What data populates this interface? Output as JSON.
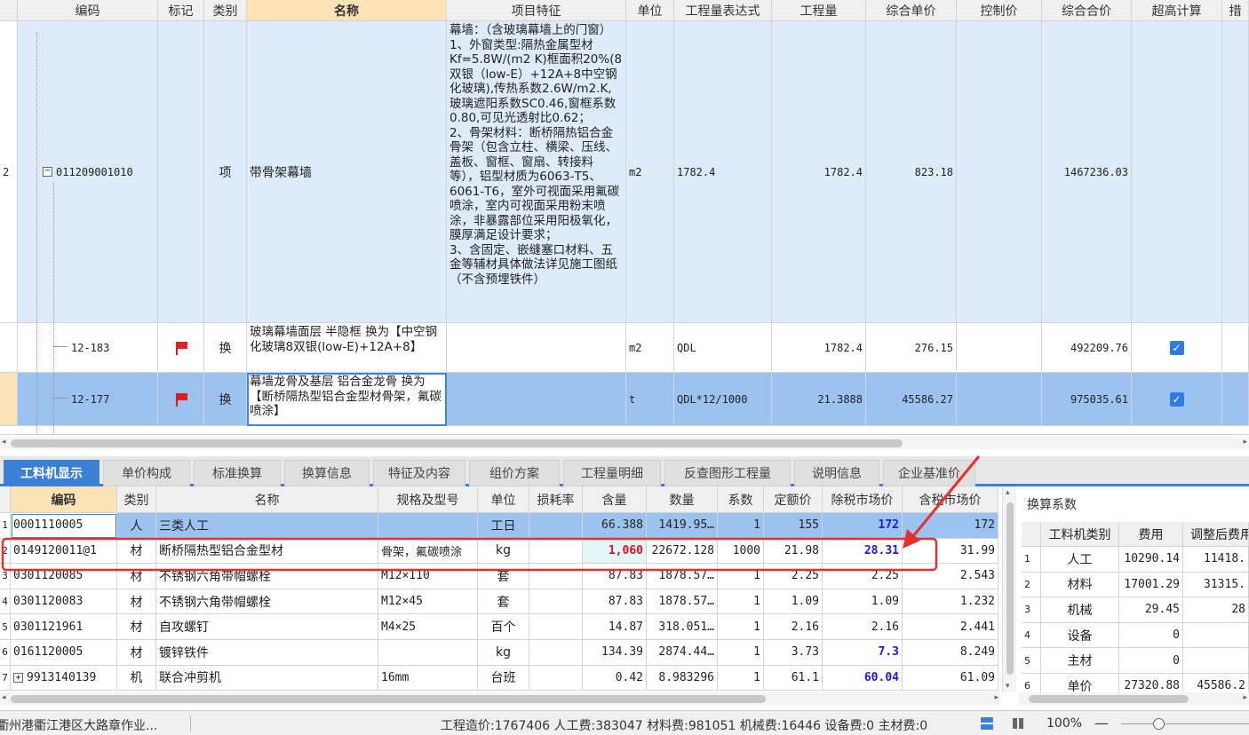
{
  "top_grid": {
    "headers": {
      "code": "编码",
      "mark": "标记",
      "type": "类别",
      "name": "名称",
      "features": "项目特征",
      "unit": "单位",
      "expr": "工程量表达式",
      "qty": "工程量",
      "unit_price": "综合单价",
      "control": "控制价",
      "total": "综合合价",
      "over_height": "超高计算",
      "extra": "措"
    },
    "rows": [
      {
        "rownum": "2",
        "code": "011209001010",
        "type": "项",
        "name": "带骨架幕墙",
        "features": "幕墙：（含玻璃幕墙上的门窗）\n1、外窗类型:隔热金属型材Kf=5.8W/(m2 K)框面积20%(8双银（low-E）+12A+8中空钢化玻璃),传热系数2.6W/m2.K,玻璃遮阳系数SC0.46,窗框系数0.80,可见光透射比0.62；\n2、骨架材料：断桥隔热铝合金骨架（包含立柱、横梁、压线、盖板、窗框、窗扇、转接料等），铝型材质为6063-T5、6061-T6，室外可视面采用氟碳喷涂，室内可视面采用粉末喷涂，非暴露部位采用阳极氧化，膜厚满足设计要求；\n3、含固定、嵌缝塞口材料、五金等辅材具体做法详见施工图纸（不含预埋铁件）",
        "unit": "m2",
        "expr": "1782.4",
        "qty": "1782.4",
        "unit_price": "823.18",
        "control": "",
        "total": "1467236.03"
      },
      {
        "rownum": "",
        "code": "12-183",
        "type": "换",
        "name": "玻璃幕墙面层 半隐框  换为【中空钢化玻璃8双银(low-E)+12A+8】",
        "features": "",
        "unit": "m2",
        "expr": "QDL",
        "qty": "1782.4",
        "unit_price": "276.15",
        "control": "",
        "total": "492209.76"
      },
      {
        "rownum": "",
        "code": "12-177",
        "type": "换",
        "name": "幕墙龙骨及基层 铝合金龙骨  换为【断桥隔热型铝合金型材骨架，氟碳喷涂】",
        "features": "",
        "unit": "t",
        "expr": "QDL*12/1000",
        "qty": "21.3888",
        "unit_price": "45586.27",
        "control": "",
        "total": "975035.61"
      }
    ]
  },
  "tabs": [
    "工料机显示",
    "单价构成",
    "标准换算",
    "换算信息",
    "特征及内容",
    "组价方案",
    "工程量明细",
    "反查图形工程量",
    "说明信息",
    "企业基准价"
  ],
  "bottom_grid": {
    "headers": {
      "code": "编码",
      "type": "类别",
      "name": "名称",
      "spec": "规格及型号",
      "unit": "单位",
      "loss": "损耗率",
      "content": "含量",
      "amount": "数量",
      "coef": "系数",
      "quota_price": "定额价",
      "market_price": "除税市场价",
      "tax_price": "含税市场价"
    },
    "rows": [
      {
        "n": "1",
        "code": "0001110005",
        "type": "人",
        "name": "三类人工",
        "spec": "",
        "unit": "工日",
        "loss": "",
        "content": "66.388",
        "amount": "1419.95…",
        "coef": "1",
        "quota": "155",
        "market": "172",
        "tax": "172"
      },
      {
        "n": "2",
        "code": "0149120011@1",
        "type": "材",
        "name": "断桥隔热型铝合金型材",
        "spec": "骨架，氟碳喷涂",
        "unit": "kg",
        "loss": "",
        "content": "1,060",
        "amount": "22672.128",
        "coef": "1000",
        "quota": "21.98",
        "market": "28.31",
        "tax": "31.99"
      },
      {
        "n": "3",
        "code": "0301120085",
        "type": "材",
        "name": "不锈钢六角带帽螺栓",
        "spec": "M12×110",
        "unit": "套",
        "loss": "",
        "content": "87.83",
        "amount": "1878.57…",
        "coef": "1",
        "quota": "2.25",
        "market": "2.25",
        "tax": "2.543"
      },
      {
        "n": "4",
        "code": "0301120083",
        "type": "材",
        "name": "不锈钢六角带帽螺栓",
        "spec": "M12×45",
        "unit": "套",
        "loss": "",
        "content": "87.83",
        "amount": "1878.57…",
        "coef": "1",
        "quota": "1.09",
        "market": "1.09",
        "tax": "1.232"
      },
      {
        "n": "5",
        "code": "0301121961",
        "type": "材",
        "name": "自攻螺钉",
        "spec": "M4×25",
        "unit": "百个",
        "loss": "",
        "content": "14.87",
        "amount": "318.051…",
        "coef": "1",
        "quota": "2.16",
        "market": "2.16",
        "tax": "2.441"
      },
      {
        "n": "6",
        "code": "0161120005",
        "type": "材",
        "name": "镀锌铁件",
        "spec": "",
        "unit": "kg",
        "loss": "",
        "content": "134.39",
        "amount": "2874.44…",
        "coef": "1",
        "quota": "3.73",
        "market": "7.3",
        "tax": "8.249"
      },
      {
        "n": "7",
        "code": "9913140139",
        "type": "机",
        "name": "联合冲剪机",
        "spec": "16mm",
        "unit": "台班",
        "loss": "",
        "content": "0.42",
        "amount": "8.983296",
        "coef": "1",
        "quota": "61.1",
        "market": "60.04",
        "tax": "61.09"
      }
    ]
  },
  "right_panel": {
    "title": "换算系数",
    "headers": {
      "type": "工料机类别",
      "fee": "费用",
      "adjusted": "调整后费用"
    },
    "rows": [
      {
        "n": "1",
        "type": "人工",
        "fee": "10290.14",
        "adjusted": "11418."
      },
      {
        "n": "2",
        "type": "材料",
        "fee": "17001.29",
        "adjusted": "31315."
      },
      {
        "n": "3",
        "type": "机械",
        "fee": "29.45",
        "adjusted": "28"
      },
      {
        "n": "4",
        "type": "设备",
        "fee": "0",
        "adjusted": ""
      },
      {
        "n": "5",
        "type": "主材",
        "fee": "0",
        "adjusted": ""
      },
      {
        "n": "6",
        "type": "单价",
        "fee": "27320.88",
        "adjusted": "45586.2"
      }
    ]
  },
  "status": {
    "project": "衢州港衢江港区大路章作业...",
    "summary": "工程造价:1767406  人工费:383047  材料费:981051  机械费:16446  设备费:0  主材费:0",
    "zoom": "100%"
  },
  "colors": {
    "accent": "#3c7fd6",
    "selection": "#9cc3ef",
    "annotation": "#e53030"
  }
}
